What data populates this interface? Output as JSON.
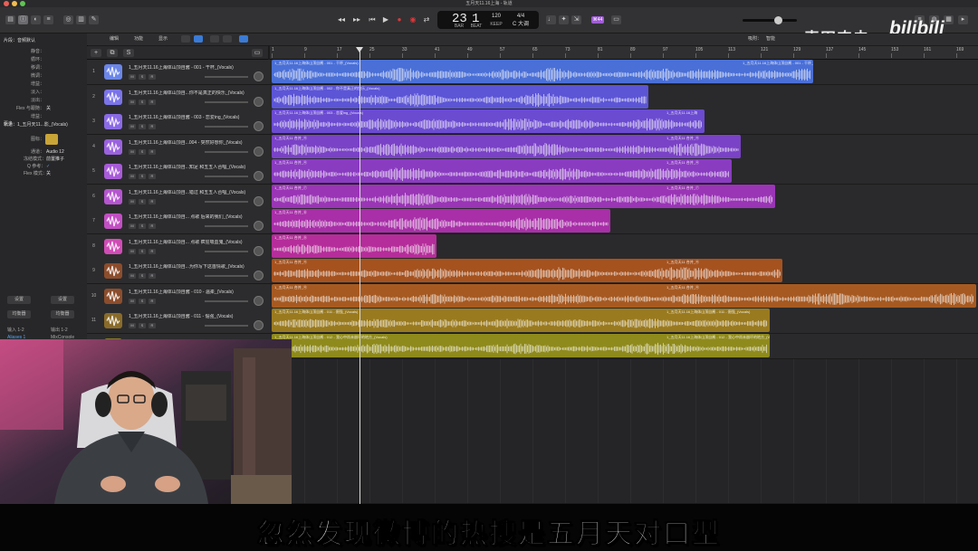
{
  "window": {
    "title": "五月天11.16上海 - 轨道"
  },
  "watermark": {
    "channel": "麦田农夫",
    "logo": "bilibili"
  },
  "lcd": {
    "bar": "23",
    "beat": "1",
    "bar_label": "BAR",
    "beat_label": "BEAT",
    "tempo": "120",
    "tempo_label": "KEEP",
    "signature": "4/4",
    "key": "C 大调"
  },
  "control": {
    "badge": "⌘44"
  },
  "inspector": {
    "region_header": "片段：音频默认",
    "region_rows": [
      "静音：",
      "循环：",
      "移调：",
      "微调：",
      "增益：",
      "淡入：",
      "淡出：",
      "Flex 与跟随：",
      "增益："
    ],
    "flex_val": "关",
    "more": "更多",
    "track_header": "轨道：1_五月天11...影_(Vocals)",
    "icon_label": "图标：",
    "track_rows": [
      {
        "label": "通道：",
        "value": "Audio 12"
      },
      {
        "label": "冻结模式：",
        "value": "前置推子"
      },
      {
        "label": "Q 参考：",
        "value": "✓"
      },
      {
        "label": "Flex 模式：",
        "value": "关"
      }
    ],
    "buttons": [
      "设置",
      "设置",
      "均衡器",
      "均衡器",
      "输入 1-2",
      "输出 1-2"
    ],
    "plugin_left": "Aliases 1",
    "plugin_right": "MixConsole"
  },
  "toolbar": {
    "edit": "编辑",
    "functions": "功能",
    "view": "显示",
    "snap_label": "吸附：",
    "snap_value": "智能"
  },
  "ruler": {
    "ticks": [
      "1",
      "9",
      "17",
      "25",
      "33",
      "41",
      "49",
      "57",
      "65",
      "73",
      "81",
      "89",
      "97",
      "105",
      "113",
      "121",
      "129",
      "137",
      "145",
      "153",
      "161",
      "169"
    ]
  },
  "tracks": [
    {
      "num": "1",
      "name": "1_五月天11.16上海体山顶自酱 - 001 - 干杯_(Vocals)",
      "color": "#4a6fd6",
      "icon": "#6b86e8"
    },
    {
      "num": "2",
      "name": "1_五月天11.16上海体山顶自...你不是真正的快乐_(Vocals)",
      "color": "#5c55d6",
      "icon": "#7b74e8"
    },
    {
      "num": "3",
      "name": "1_五月天11.16上海体山顶自酱 - 003 - 恋爱ing_(Vocals)",
      "color": "#6b4bd0",
      "icon": "#8a6ae6"
    },
    {
      "num": "4",
      "name": "1_五月天11.16上海体山顶自...004 - 突然好想你_(Vocals)",
      "color": "#7a42c6",
      "icon": "#9a62de"
    },
    {
      "num": "5",
      "name": "1_五月天11.16上海体山顶自...知足 和五五人合唱_(Vocals)",
      "color": "#8a3cc0",
      "icon": "#a85bd8"
    },
    {
      "num": "6",
      "name": "1_五月天11.16上海体山顶自...错过 和五五人合唱_(Vocals)",
      "color": "#9a35b6",
      "icon": "#b555cf"
    },
    {
      "num": "7",
      "name": "1_五月天11.16上海体山顶自... 点歌 后来的我们_(Vocals)",
      "color": "#a82fa8",
      "icon": "#c24fc4"
    },
    {
      "num": "8",
      "name": "1_五月天11.16上海体山顶自... 点歌 疯狂吸血鬼_(Vocals)",
      "color": "#b52d9a",
      "icon": "#d04cb5"
    },
    {
      "num": "9",
      "name": "1_五月天11.16上海体山顶自...为你写下这首情歌_(Vocals)",
      "color": "#a5521f",
      "icon": "#8c4d2c"
    },
    {
      "num": "10",
      "name": "1_五月天11.16上海体山顶自酱 - 010 - 温柔_(Vocals)",
      "color": "#a65a22",
      "icon": "#8c4d2c"
    },
    {
      "num": "11",
      "name": "1_五月天11.16上海体山顶自酱 - 011 - 倔强_(Vocals)",
      "color": "#9a7a1e",
      "icon": "#8a6b2a"
    },
    {
      "num": "12",
      "name": "1_五月天11.16上海体山顶自酱 - 012 - 我心中尚未崩坏的地方_(Vocals)",
      "color": "#8f8a1c",
      "icon": "#8a7b2a"
    }
  ],
  "regions": [
    {
      "title": "1_五月天11.16上海体山顶自酱 - 001 - 干杯_(Vocals)",
      "title2": "1_五月天11.16上海体山顶自酱 - 001 - 干杯_(Vocals)"
    },
    {
      "title": "1_五月天11.16上海体山顶自酱 - 002 - 你不是真正的快乐_(Vocals)",
      "title2": ""
    },
    {
      "title": "1_五月天11.16上海体山顶自酱 - 003 - 恋爱ing_(Vocals)",
      "title2": "1_五月天11.16上海"
    },
    {
      "title": "1_五月天11 合并_④",
      "title2": "1_五月天11 合并_④"
    },
    {
      "title": "1_五月天11 合并_④",
      "title2": "1_五月天11 合并_④"
    },
    {
      "title": "1_五月天11 合并_⑦",
      "title2": "1_五月天11 合并_⑦"
    },
    {
      "title": "1_五月天11 合并_⑧",
      "title2": ""
    },
    {
      "title": "1_五月天11 合并_⑨",
      "title2": ""
    },
    {
      "title": "1_五月天11 合并_④",
      "title2": "1_五月天11 合并_④"
    },
    {
      "title": "1_五月天11 合并_④",
      "title2": "1_五月天11 合并_④"
    },
    {
      "title": "1_五月天11.16上海体山顶自酱 - 011 - 倔强_(Vocals)",
      "title2": "1_五月天11.16上海体山顶自酱 - 011 - 倔强_(Vocals)"
    },
    {
      "title": "1_五月天11.16上海体山顶自酱 - 012 - 我心中尚未崩坏的地方_(Vocals)",
      "title2": "1_五月天11.16上海体山顶自酱 - 012 - 我心中尚未崩坏的地方_(Vocals)"
    }
  ],
  "subtitle": "忽然发现微博的热搜是五月天对口型"
}
